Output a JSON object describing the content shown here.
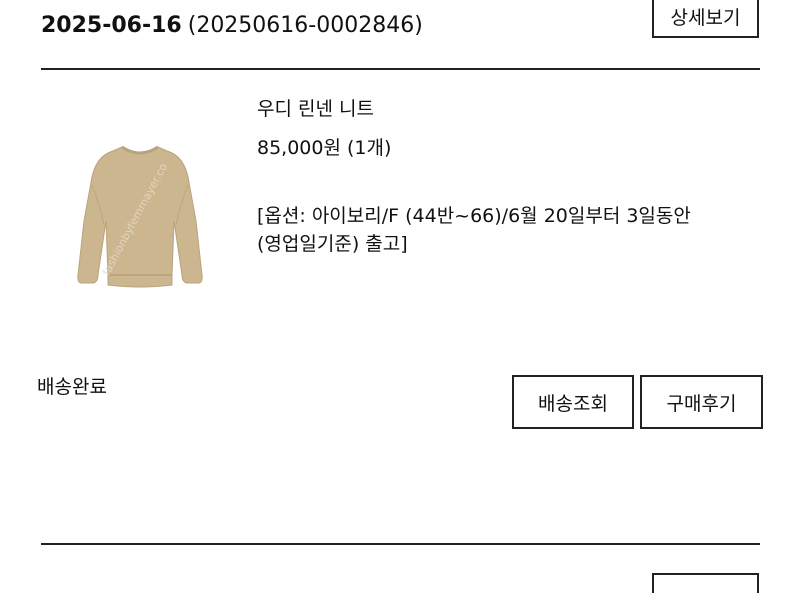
{
  "order": {
    "date": "2025-06-16",
    "number": "(20250616-0002846)",
    "detail_button": "상세보기"
  },
  "item": {
    "thumbnail": "beige-linen-knit-sweater",
    "watermark": "fashionbyfemmayer.co",
    "name": "우디 린넨 니트",
    "price": "85,000원 (1개)",
    "option_line1": "[옵션: 아이보리/F (44반~66)/6월 20일부터 3일동안",
    "option_line2": "(영업일기준) 출고]"
  },
  "status": {
    "label": "배송완료",
    "track_button": "배송조회",
    "review_button": "구매후기"
  },
  "colors": {
    "border": "#222222",
    "sweater": "#cbb690"
  }
}
